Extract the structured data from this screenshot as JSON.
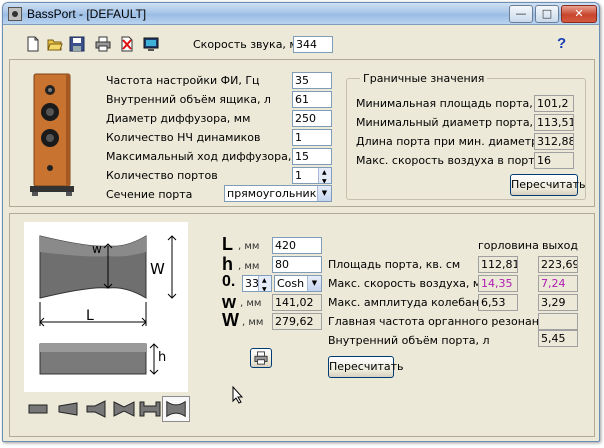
{
  "window": {
    "title": "BassPort - [DEFAULT]"
  },
  "toolbar": {
    "icons": [
      "new-file-icon",
      "open-folder-icon",
      "save-icon",
      "print-icon",
      "delete-icon",
      "monitor-icon"
    ],
    "sound_speed_label": "Скорость звука, м /с",
    "sound_speed_value": "344",
    "help_label": "?"
  },
  "params": {
    "rows": [
      {
        "label": "Частота настройки ФИ, Гц",
        "value": "35"
      },
      {
        "label": "Внутренний объём ящика, л",
        "value": "61"
      },
      {
        "label": "Диаметр диффузора, мм",
        "value": "250"
      },
      {
        "label": "Количество НЧ динамиков",
        "value": "1"
      },
      {
        "label": "Максимальный ход диффузора, мм",
        "value": "15"
      },
      {
        "label": "Количество портов",
        "value": "1"
      }
    ],
    "section_label": "Сечение порта",
    "section_value": "прямоугольник"
  },
  "limits": {
    "title": "Граничные значения",
    "rows": [
      {
        "label": "Минимальная площадь порта, кв.см.",
        "value": "101,2"
      },
      {
        "label": "Минимальный диаметр порта, мм",
        "value": "113,51"
      },
      {
        "label": "Длина порта при мин. диаметре, мм",
        "value": "312,88"
      },
      {
        "label": "Макс. скорость воздуха в порте, м /с",
        "value": "16"
      }
    ],
    "recalc_label": "Пересчитать"
  },
  "dims": {
    "L": {
      "symbol": "L",
      "unit": ", мм",
      "value": "420"
    },
    "h": {
      "symbol": "h",
      "unit": ", мм",
      "value": "80"
    },
    "o": {
      "symbol": "0.",
      "value": "33",
      "curve": "Cosh"
    },
    "w": {
      "symbol": "w",
      "unit": ", мм",
      "value": "141,02"
    },
    "W": {
      "symbol": "W",
      "unit": ", мм",
      "value": "279,62"
    },
    "print_icon": "print-icon"
  },
  "diagram": {
    "label_w": "w",
    "label_W": "W",
    "label_L": "L",
    "label_h": "h"
  },
  "results": {
    "col_throat": "горловина",
    "col_outlet": "выход",
    "rows": [
      {
        "label": "Площадь порта, кв. см",
        "throat": "112,81",
        "outlet": "223,69"
      },
      {
        "label": "Макс. скорость воздуха, м / с",
        "throat": "14,35",
        "outlet": "7,24"
      },
      {
        "label": "Макс. амплитуда колебаний, см",
        "throat": "6,53",
        "outlet": "3,29"
      },
      {
        "label": "Главная частота органного резонанса, Гц",
        "throat": "",
        "outlet": ""
      },
      {
        "label": "Внутренний объём порта, л",
        "throat": "",
        "outlet": "5,45"
      }
    ],
    "recalc_label": "Пересчитать"
  },
  "colors": {
    "accent_value": "#b21cb2",
    "wood": "#c8732f"
  }
}
